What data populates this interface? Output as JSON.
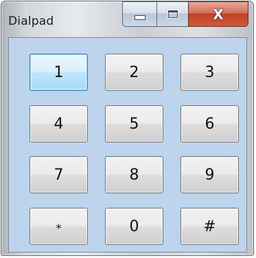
{
  "window": {
    "title": "Dialpad",
    "controls": {
      "minimize": "minimize-icon",
      "maximize": "maximize-icon",
      "close": "close-icon"
    },
    "close_symbol": "X"
  },
  "dialpad": {
    "focused_key": "1",
    "keys": [
      "1",
      "2",
      "3",
      "4",
      "5",
      "6",
      "7",
      "8",
      "9",
      "*",
      "0",
      "#"
    ]
  },
  "colors": {
    "client_background": "#bcd4ec",
    "close_button": "#c9492e",
    "focus_border": "#3c7fb1"
  }
}
